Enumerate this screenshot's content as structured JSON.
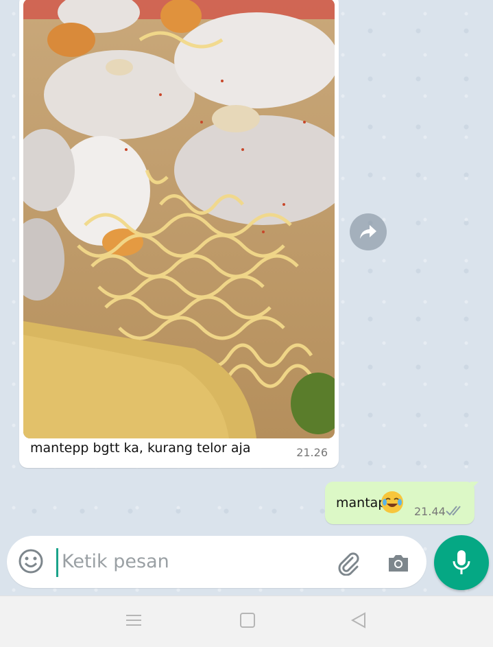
{
  "incoming_message": {
    "caption": "mantepp bgtt ka, kurang telor aja",
    "time": "21.26"
  },
  "outgoing_message": {
    "text": "mantap",
    "emoji": "face-with-tears-of-joy",
    "time": "21.44",
    "status": "read-double-check"
  },
  "composer": {
    "placeholder": "Ketik pesan"
  },
  "colors": {
    "accent": "#05a884",
    "outgoing_bubble": "#dcf8c6",
    "chat_background": "#dae3ec"
  },
  "icons": {
    "forward": "forward-arrow-icon",
    "emoji": "smiley-icon",
    "attach": "paperclip-icon",
    "camera": "camera-icon",
    "mic": "microphone-icon",
    "nav_menu": "menu-icon",
    "nav_home": "square-home-icon",
    "nav_back": "triangle-back-icon"
  }
}
